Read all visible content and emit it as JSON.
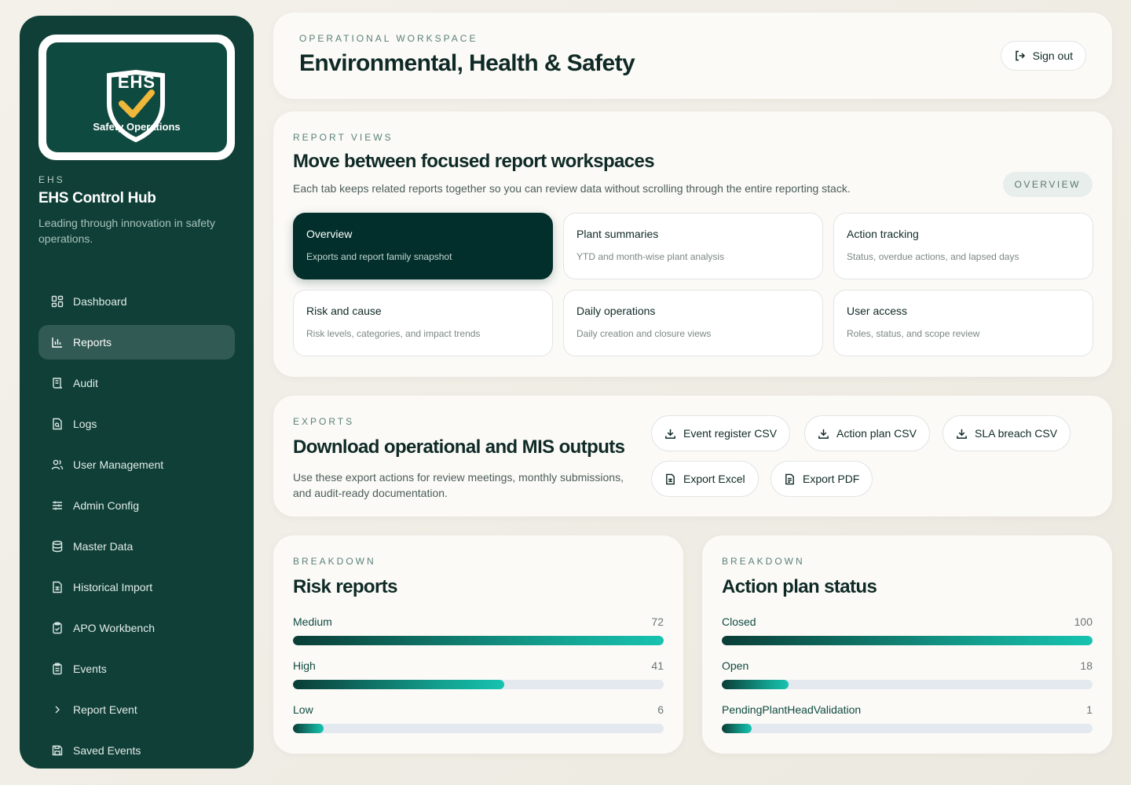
{
  "logo": {
    "abbr": "EHS",
    "sub": "Safety Operations"
  },
  "brand": {
    "eyebrow": "EHS",
    "title": "EHS Control Hub",
    "tagline": "Leading through innovation in safety operations."
  },
  "nav": [
    {
      "label": "Dashboard",
      "icon": "dashboard-icon",
      "active": false
    },
    {
      "label": "Reports",
      "icon": "bar-chart-icon",
      "active": true
    },
    {
      "label": "Audit",
      "icon": "scroll-icon",
      "active": false
    },
    {
      "label": "Logs",
      "icon": "file-search-icon",
      "active": false
    },
    {
      "label": "User Management",
      "icon": "users-icon",
      "active": false
    },
    {
      "label": "Admin Config",
      "icon": "sliders-icon",
      "active": false
    },
    {
      "label": "Master Data",
      "icon": "database-icon",
      "active": false
    },
    {
      "label": "Historical Import",
      "icon": "file-sheet-icon",
      "active": false
    },
    {
      "label": "APO Workbench",
      "icon": "clipboard-check-icon",
      "active": false
    },
    {
      "label": "Events",
      "icon": "clipboard-list-icon",
      "active": false
    },
    {
      "label": "Report Event",
      "icon": "chevron-right-icon",
      "active": false
    },
    {
      "label": "Saved Events",
      "icon": "save-icon",
      "active": false
    }
  ],
  "header": {
    "eyebrow": "OPERATIONAL WORKSPACE",
    "title": "Environmental, Health & Safety",
    "signout": "Sign out"
  },
  "views": {
    "eyebrow": "REPORT VIEWS",
    "title": "Move between focused report workspaces",
    "description": "Each tab keeps related reports together so you can review data without scrolling through the entire reporting stack.",
    "badge": "OVERVIEW",
    "tabs": [
      {
        "title": "Overview",
        "sub": "Exports and report family snapshot",
        "active": true
      },
      {
        "title": "Plant summaries",
        "sub": "YTD and month-wise plant analysis",
        "active": false
      },
      {
        "title": "Action tracking",
        "sub": "Status, overdue actions, and lapsed days",
        "active": false
      },
      {
        "title": "Risk and cause",
        "sub": "Risk levels, categories, and impact trends",
        "active": false
      },
      {
        "title": "Daily operations",
        "sub": "Daily creation and closure views",
        "active": false
      },
      {
        "title": "User access",
        "sub": "Roles, status, and scope review",
        "active": false
      }
    ]
  },
  "exports": {
    "eyebrow": "EXPORTS",
    "title": "Download operational and MIS outputs",
    "description": "Use these export actions for review meetings, monthly submissions, and audit-ready documentation.",
    "buttons": {
      "event_register": "Event register CSV",
      "action_plan": "Action plan CSV",
      "sla_breach": "SLA breach CSV",
      "excel": "Export Excel",
      "pdf": "Export PDF"
    }
  },
  "risk": {
    "eyebrow": "BREAKDOWN",
    "title": "Risk reports",
    "max": 72,
    "rows": [
      {
        "label": "Medium",
        "value": 72
      },
      {
        "label": "High",
        "value": 41
      },
      {
        "label": "Low",
        "value": 6
      }
    ]
  },
  "action": {
    "eyebrow": "BREAKDOWN",
    "title": "Action plan status",
    "max": 100,
    "rows": [
      {
        "label": "Closed",
        "value": 100
      },
      {
        "label": "Open",
        "value": 18
      },
      {
        "label": "PendingPlantHeadValidation",
        "value": 1
      }
    ]
  }
}
